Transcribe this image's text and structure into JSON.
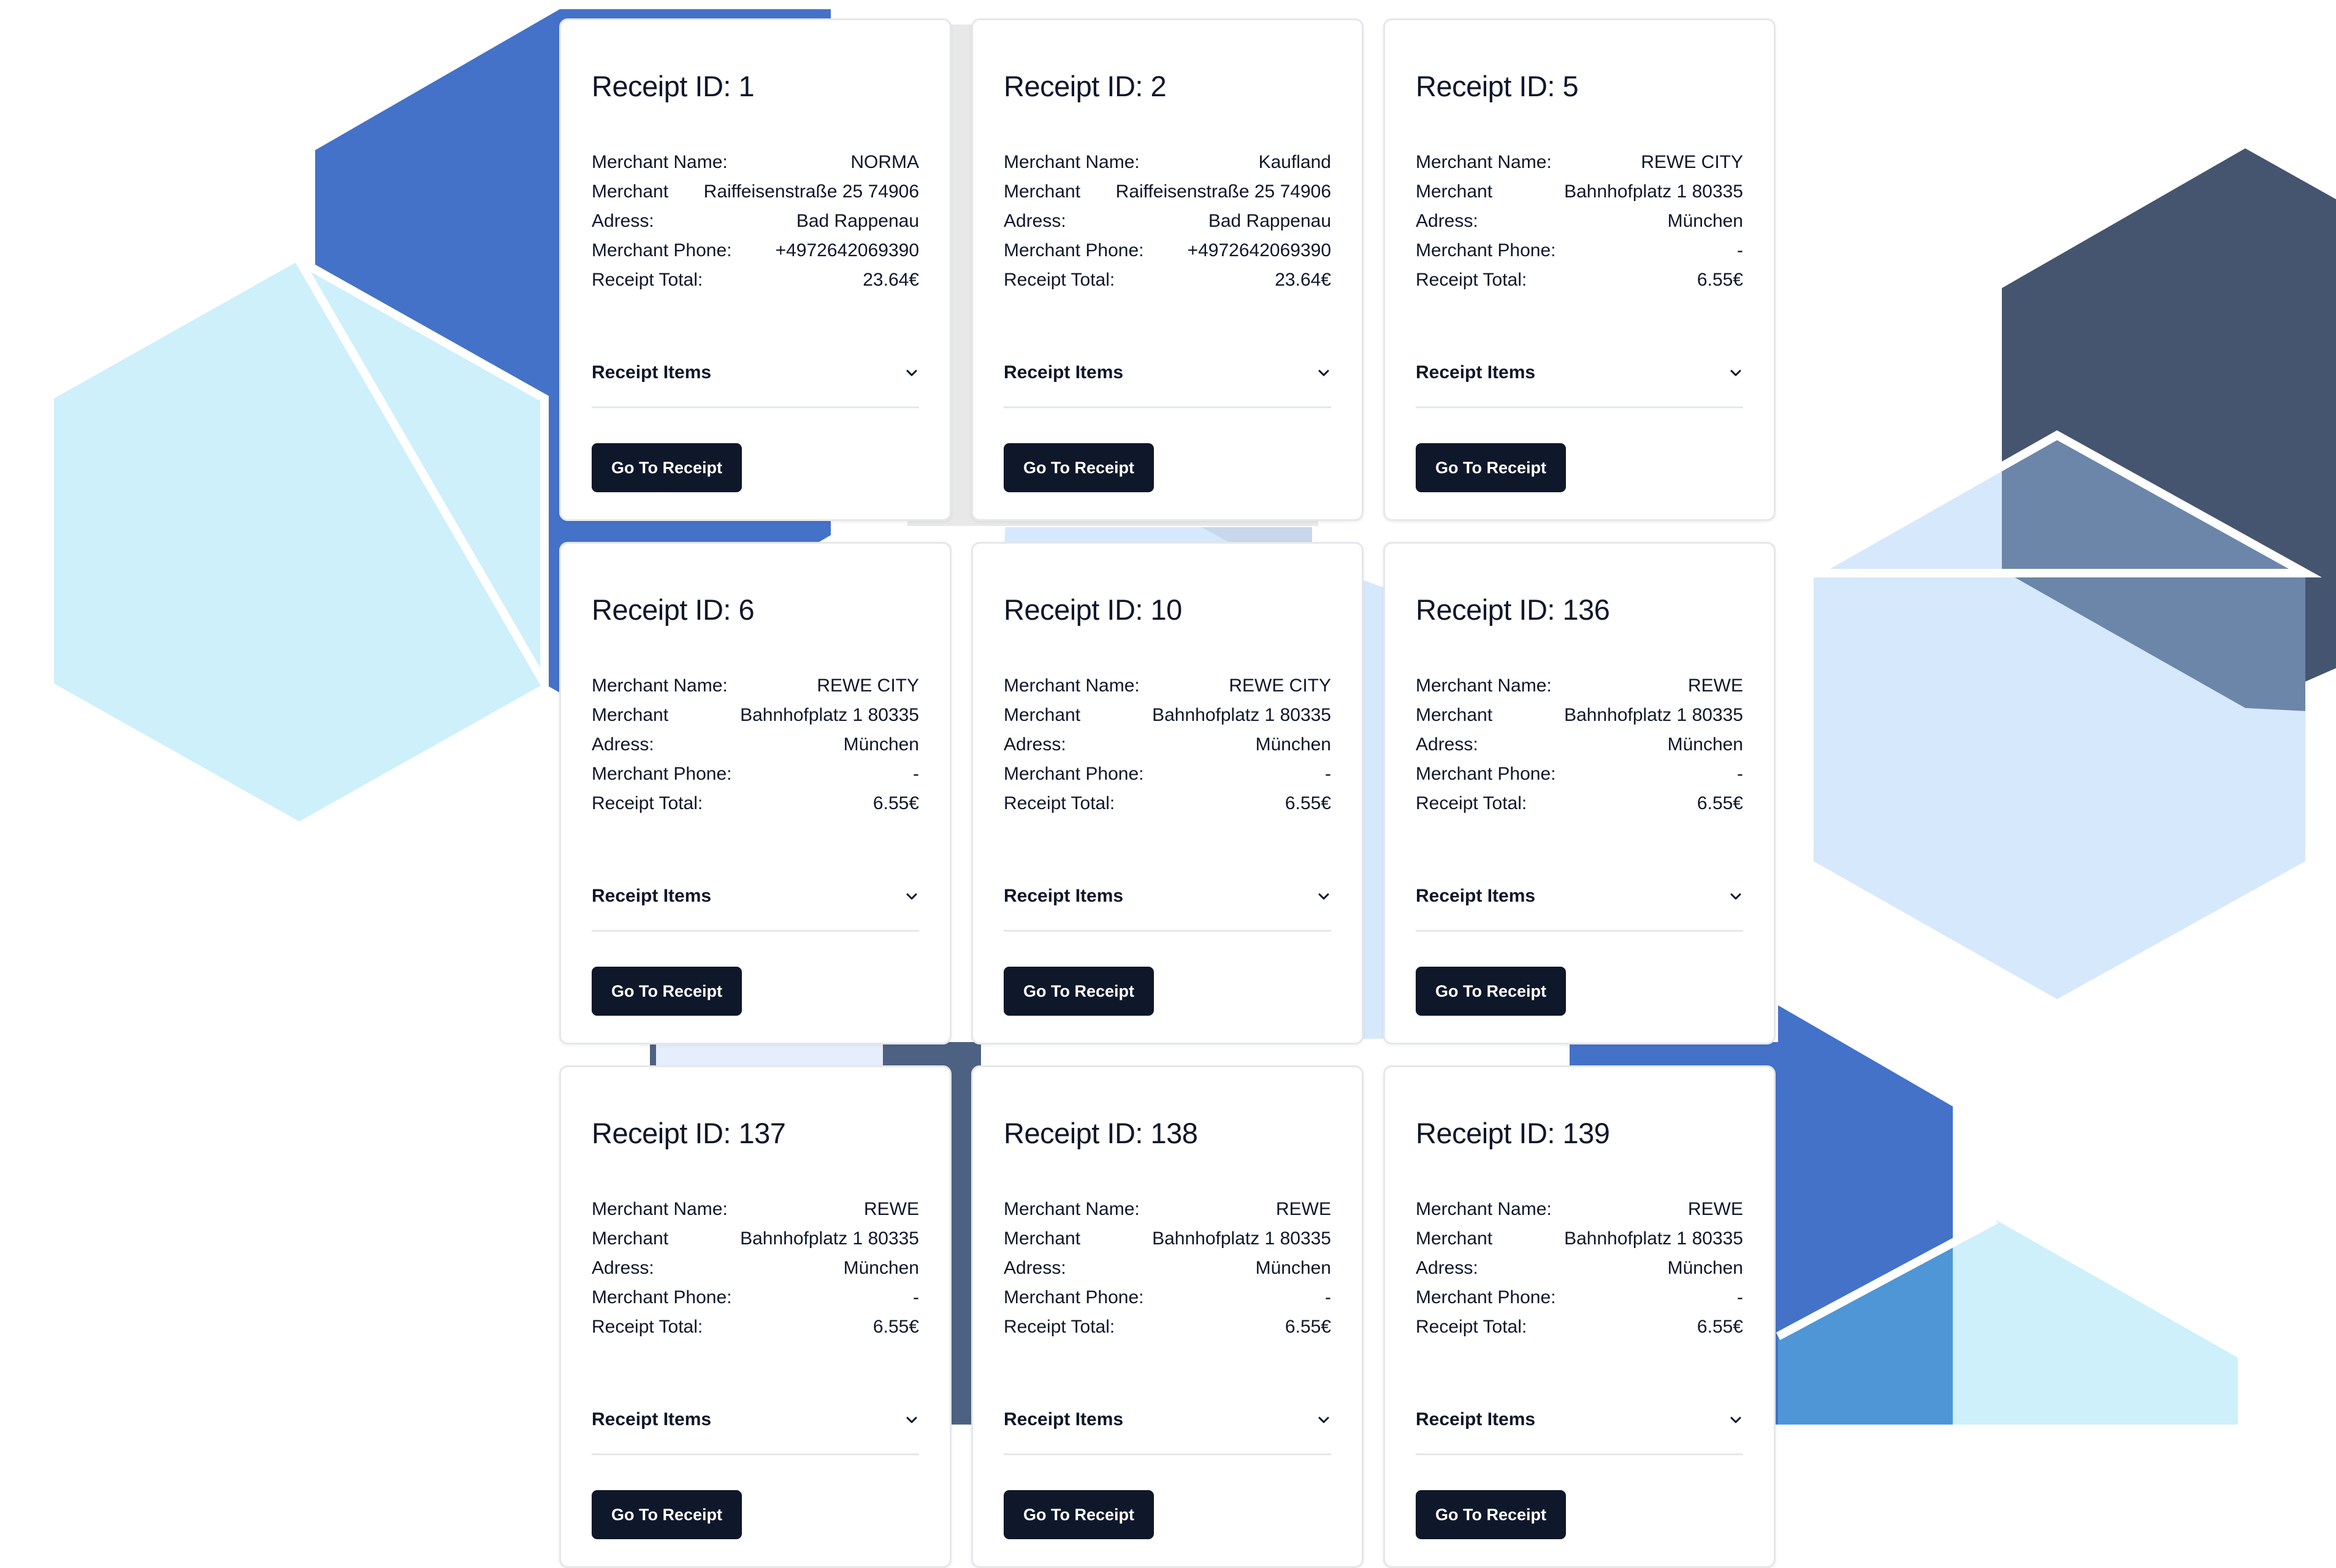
{
  "labels": {
    "receipt_id_prefix": "Receipt ID: ",
    "merchant_name": "Merchant Name:",
    "merchant_address_line1": "Merchant",
    "merchant_address_line2": "Adress:",
    "merchant_phone": "Merchant Phone:",
    "receipt_total": "Receipt Total:",
    "receipt_items": "Receipt Items",
    "go_to_receipt": "Go To Receipt"
  },
  "icons": {
    "accordion": "chevron-down-icon"
  },
  "colors": {
    "button_bg": "#0f172a",
    "hex_blue": "#4472c8",
    "hex_mid_blue": "#4f96d6",
    "hex_pale_cyan": "#cdf0fb",
    "hex_pale_blue": "#d6e8fc",
    "hex_slate": "#45556f",
    "hex_gray": "#e6e6e6"
  },
  "receipts": [
    {
      "title": "Receipt ID: 1",
      "merchant_name": "NORMA",
      "address_line1": "Raiffeisenstraße 25 74906",
      "address_line2": "Bad Rappenau",
      "phone": "+4972642069390",
      "total": "23.64€"
    },
    {
      "title": "Receipt ID: 2",
      "merchant_name": "Kaufland",
      "address_line1": "Raiffeisenstraße 25 74906",
      "address_line2": "Bad Rappenau",
      "phone": "+4972642069390",
      "total": "23.64€"
    },
    {
      "title": "Receipt ID: 5",
      "merchant_name": "REWE CITY",
      "address_line1": "Bahnhofplatz 1 80335",
      "address_line2": "München",
      "phone": "-",
      "total": "6.55€"
    },
    {
      "title": "Receipt ID: 6",
      "merchant_name": "REWE CITY",
      "address_line1": "Bahnhofplatz 1 80335",
      "address_line2": "München",
      "phone": "-",
      "total": "6.55€"
    },
    {
      "title": "Receipt ID: 10",
      "merchant_name": "REWE CITY",
      "address_line1": "Bahnhofplatz 1 80335",
      "address_line2": "München",
      "phone": "-",
      "total": "6.55€"
    },
    {
      "title": "Receipt ID: 136",
      "merchant_name": "REWE",
      "address_line1": "Bahnhofplatz 1 80335",
      "address_line2": "München",
      "phone": "-",
      "total": "6.55€"
    },
    {
      "title": "Receipt ID: 137",
      "merchant_name": "REWE",
      "address_line1": "Bahnhofplatz 1 80335",
      "address_line2": "München",
      "phone": "-",
      "total": "6.55€"
    },
    {
      "title": "Receipt ID: 138",
      "merchant_name": "REWE",
      "address_line1": "Bahnhofplatz 1 80335",
      "address_line2": "München",
      "phone": "-",
      "total": "6.55€"
    },
    {
      "title": "Receipt ID: 139",
      "merchant_name": "REWE",
      "address_line1": "Bahnhofplatz 1 80335",
      "address_line2": "München",
      "phone": "-",
      "total": "6.55€"
    }
  ]
}
